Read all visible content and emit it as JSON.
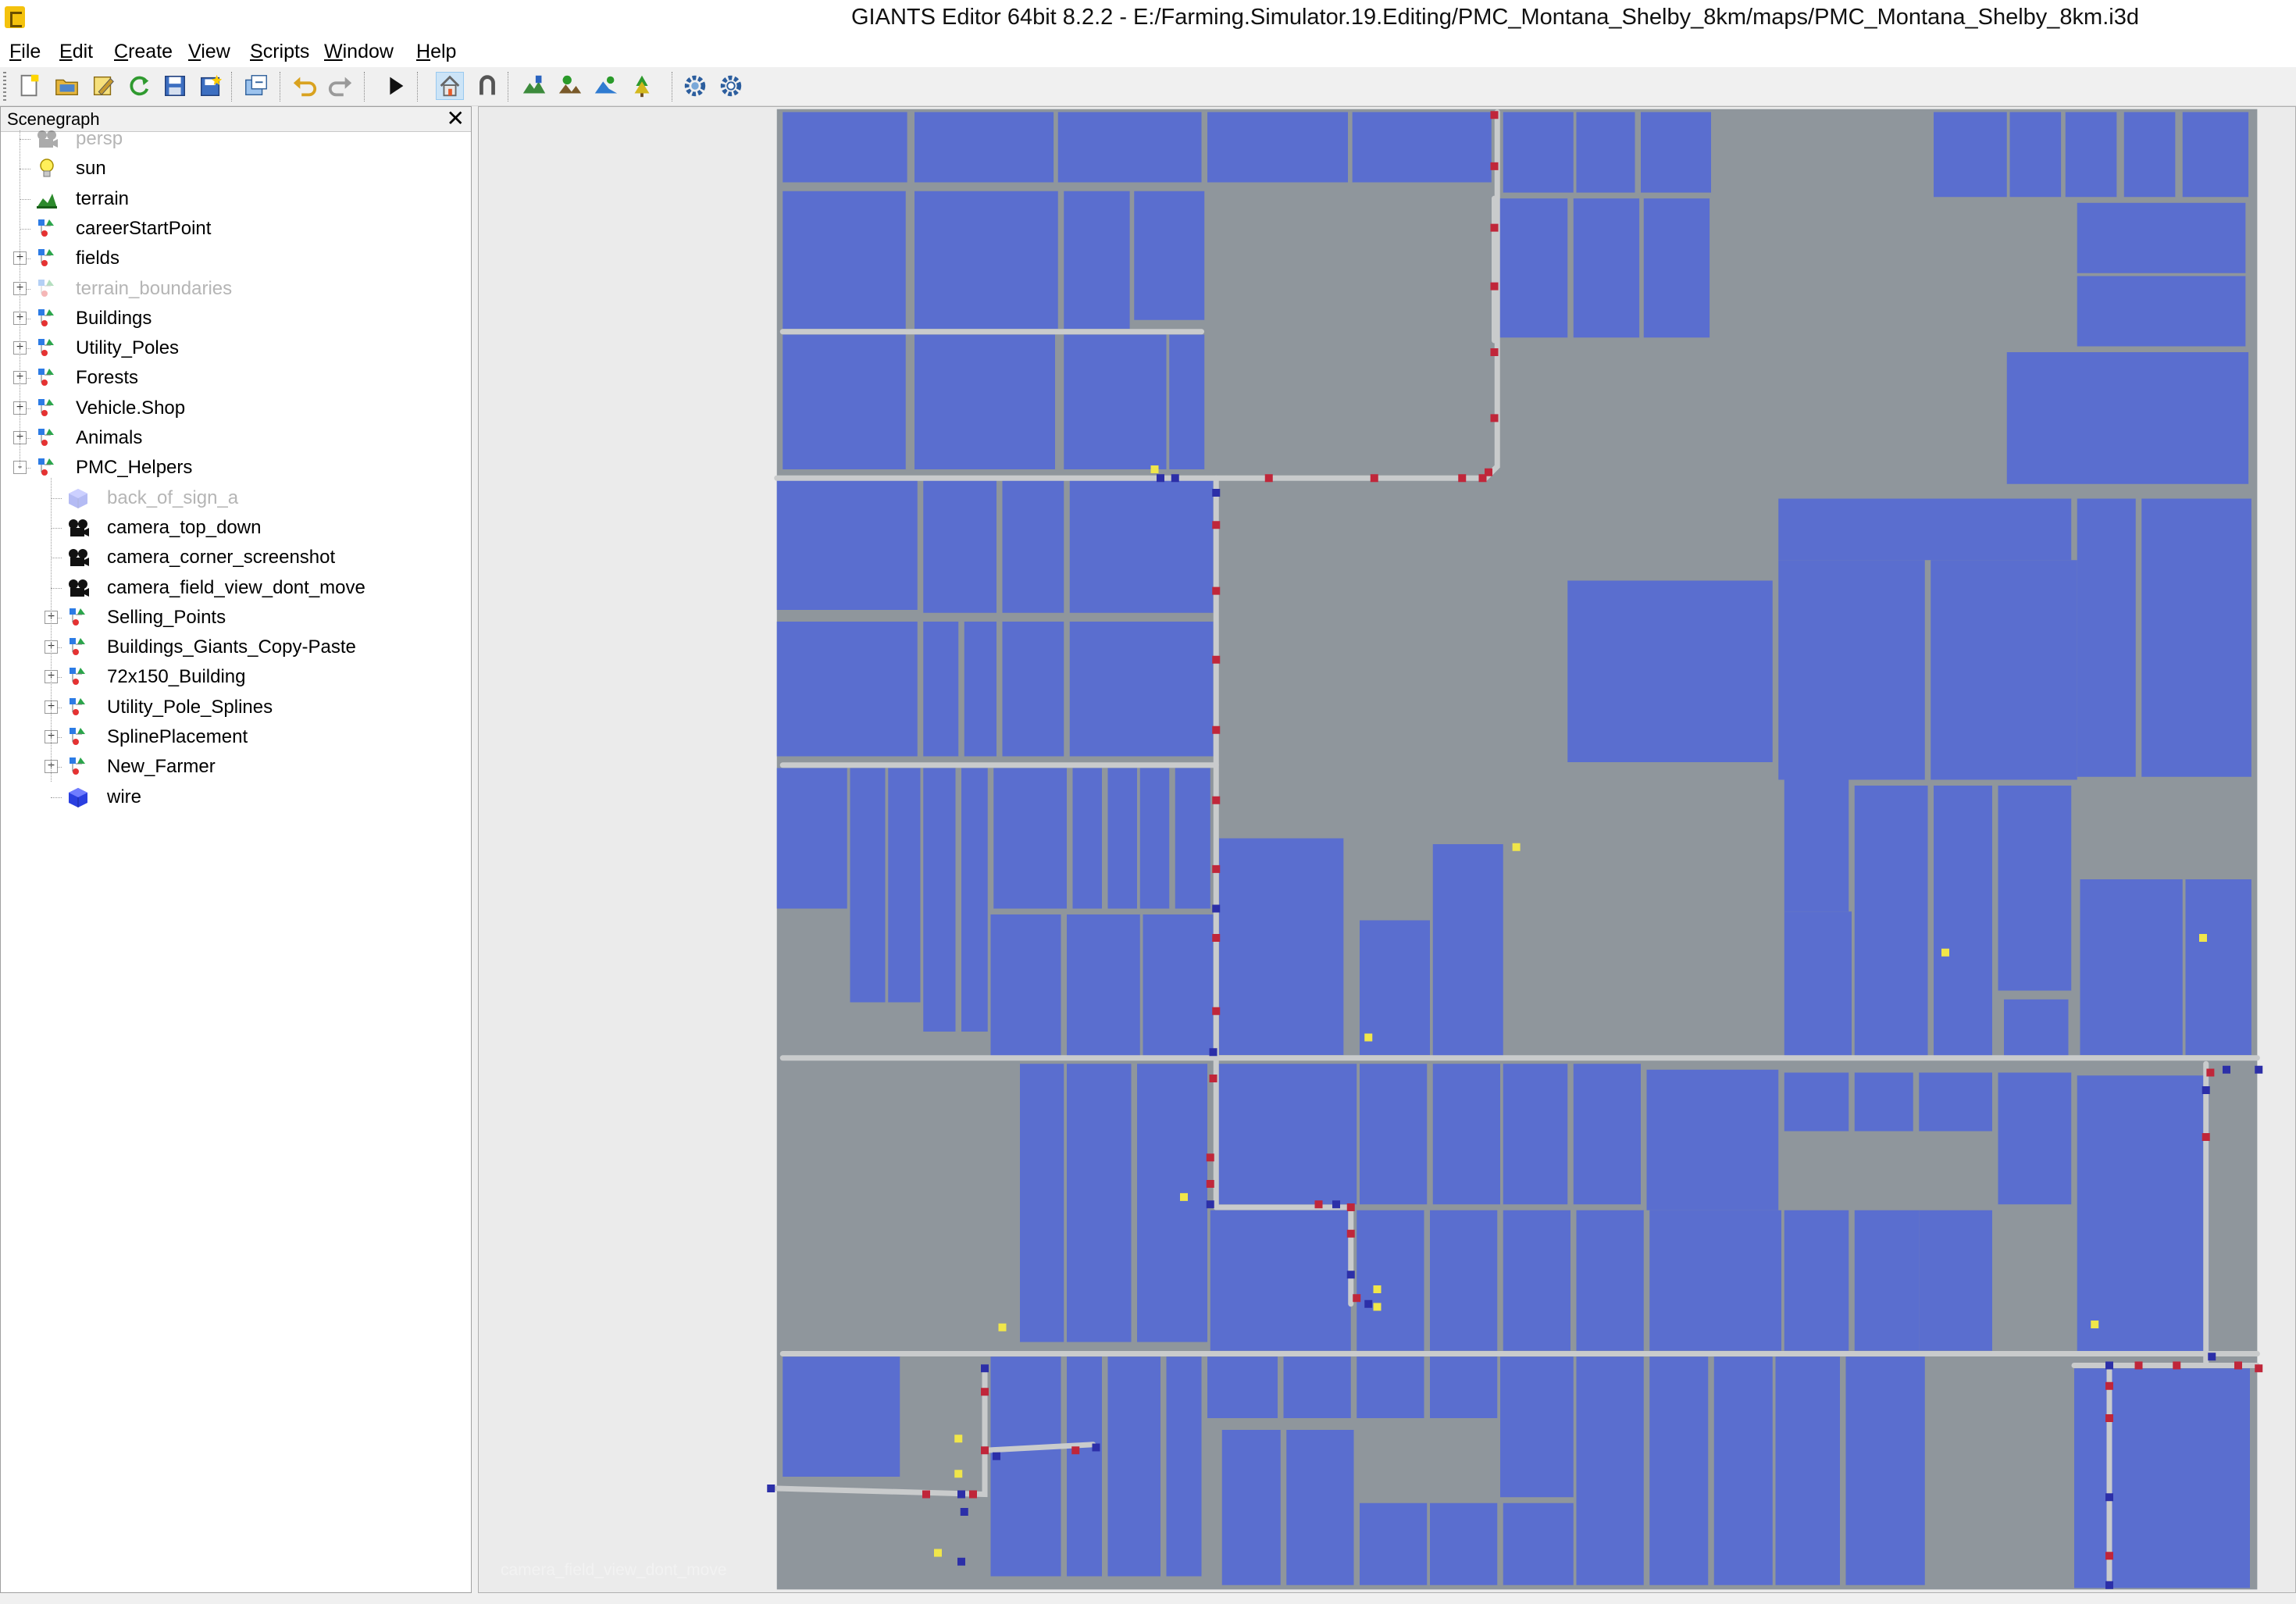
{
  "window": {
    "title": "GIANTS Editor 64bit 8.2.2 - E:/Farming.Simulator.19.Editing/PMC_Montana_Shelby_8km/maps/PMC_Montana_Shelby_8km.i3d"
  },
  "menu": {
    "items": [
      {
        "label": "File",
        "u": "F",
        "rest": "ile"
      },
      {
        "label": "Edit",
        "u": "E",
        "rest": "dit"
      },
      {
        "label": "Create",
        "u": "C",
        "rest": "reate"
      },
      {
        "label": "View",
        "u": "V",
        "rest": "iew"
      },
      {
        "label": "Scripts",
        "u": "S",
        "rest": "cripts"
      },
      {
        "label": "Window",
        "u": "W",
        "rest": "indow"
      },
      {
        "label": "Help",
        "u": "H",
        "rest": "elp"
      }
    ]
  },
  "toolbar": {
    "buttons": [
      "new-file-icon",
      "open-file-icon",
      "edit-file-icon",
      "reload-icon",
      "save-icon",
      "save-as-icon",
      "import-icon",
      "undo-icon",
      "redo-icon",
      "play-icon",
      "home-icon",
      "magnet-icon",
      "terrain-paint-icon",
      "terrain-foliage-icon",
      "terrain-sculpt-icon",
      "foliage-paint-icon",
      "settings-gear-icon",
      "refresh-gear-icon"
    ]
  },
  "scenegraph": {
    "title": "Scenegraph",
    "close": "✕",
    "nodes": [
      {
        "label": "persp",
        "icon": "camera-icon",
        "depth": 0,
        "dim": true,
        "expander": ""
      },
      {
        "label": "sun",
        "icon": "lightbulb-icon",
        "depth": 0,
        "dim": false,
        "expander": ""
      },
      {
        "label": "terrain",
        "icon": "terrain-icon",
        "depth": 0,
        "dim": false,
        "expander": ""
      },
      {
        "label": "careerStartPoint",
        "icon": "transform-group-icon",
        "depth": 0,
        "dim": false,
        "expander": ""
      },
      {
        "label": "fields",
        "icon": "transform-group-icon",
        "depth": 0,
        "dim": false,
        "expander": "+"
      },
      {
        "label": "terrain_boundaries",
        "icon": "transform-group-icon",
        "depth": 0,
        "dim": true,
        "expander": "+"
      },
      {
        "label": "Buildings",
        "icon": "transform-group-icon",
        "depth": 0,
        "dim": false,
        "expander": "+"
      },
      {
        "label": "Utility_Poles",
        "icon": "transform-group-icon",
        "depth": 0,
        "dim": false,
        "expander": "+"
      },
      {
        "label": "Forests",
        "icon": "transform-group-icon",
        "depth": 0,
        "dim": false,
        "expander": "+"
      },
      {
        "label": "Vehicle.Shop",
        "icon": "transform-group-icon",
        "depth": 0,
        "dim": false,
        "expander": "+"
      },
      {
        "label": "Animals",
        "icon": "transform-group-icon",
        "depth": 0,
        "dim": false,
        "expander": "+"
      },
      {
        "label": "PMC_Helpers",
        "icon": "transform-group-icon",
        "depth": 0,
        "dim": false,
        "expander": "-"
      },
      {
        "label": "back_of_sign_a",
        "icon": "shape-cube-icon",
        "depth": 1,
        "dim": true,
        "expander": ""
      },
      {
        "label": "camera_top_down",
        "icon": "camera-icon",
        "depth": 1,
        "dim": false,
        "expander": ""
      },
      {
        "label": "camera_corner_screenshot",
        "icon": "camera-icon",
        "depth": 1,
        "dim": false,
        "expander": ""
      },
      {
        "label": "camera_field_view_dont_move",
        "icon": "camera-icon",
        "depth": 1,
        "dim": false,
        "expander": ""
      },
      {
        "label": "Selling_Points",
        "icon": "transform-group-icon",
        "depth": 1,
        "dim": false,
        "expander": "+"
      },
      {
        "label": "Buildings_Giants_Copy-Paste",
        "icon": "transform-group-icon",
        "depth": 1,
        "dim": false,
        "expander": "+"
      },
      {
        "label": "72x150_Building",
        "icon": "transform-group-icon",
        "depth": 1,
        "dim": false,
        "expander": "+"
      },
      {
        "label": "Utility_Pole_Splines",
        "icon": "transform-group-icon",
        "depth": 1,
        "dim": false,
        "expander": "+"
      },
      {
        "label": "SplinePlacement",
        "icon": "transform-group-icon",
        "depth": 1,
        "dim": false,
        "expander": "+"
      },
      {
        "label": "New_Farmer",
        "icon": "transform-group-icon",
        "depth": 1,
        "dim": false,
        "expander": "+"
      },
      {
        "label": "wire",
        "icon": "shape-cube-icon",
        "depth": 1,
        "dim": false,
        "expander": ""
      }
    ]
  },
  "viewport": {
    "camera_label": "camera_field_view_dont_move",
    "colors": {
      "background": "#ebebeb",
      "terrain": "#8f969c",
      "field": "#5369d6",
      "road": "#c9cbcc",
      "marker_red": "#c0263a",
      "marker_blue": "#2c2fa8",
      "marker_yellow": "#f0e64a"
    }
  }
}
